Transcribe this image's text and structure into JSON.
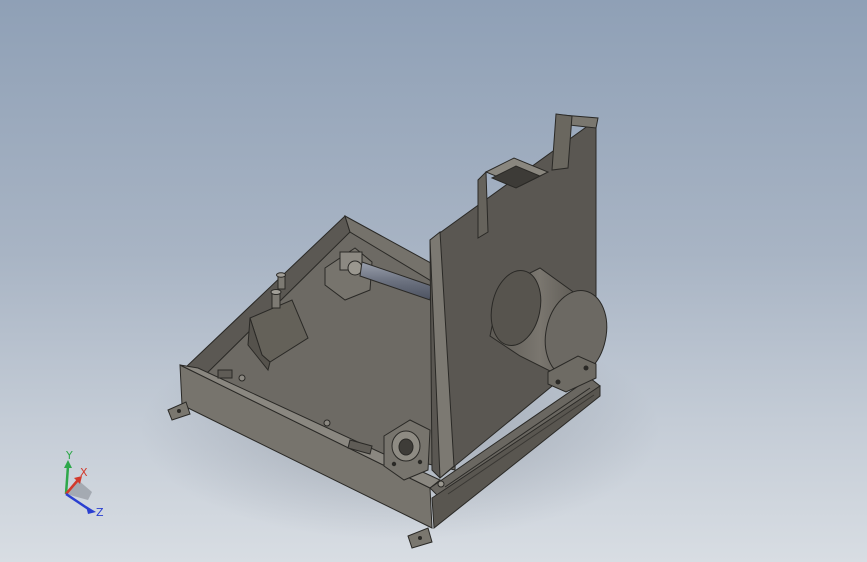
{
  "viewport": {
    "background_top": "#8fa0b6",
    "background_bottom": "#d8dde3",
    "part_color": "#6f6c66"
  },
  "triad": {
    "x_label": "X",
    "y_label": "Y",
    "z_label": "Z",
    "x_color": "#d23a2c",
    "y_color": "#2ea84a",
    "z_color": "#2a3fd1"
  }
}
